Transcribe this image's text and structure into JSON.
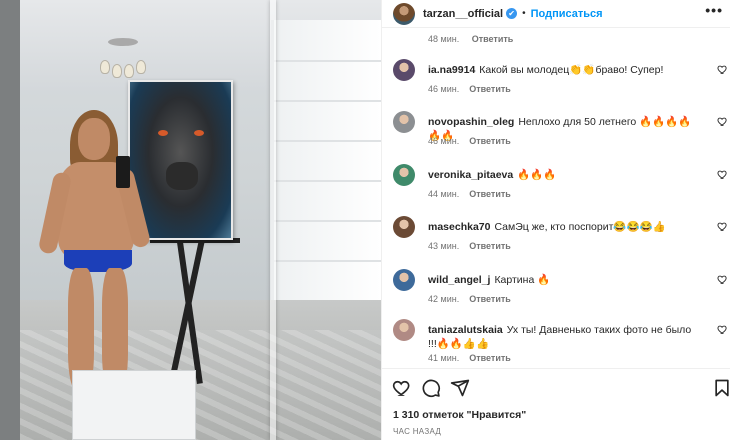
{
  "post": {
    "username": "tarzan__official",
    "verified_mark": "✔",
    "separator": "•",
    "follow_label": "Подписаться",
    "more_label": "•••",
    "photo_alt_icon": "post-photo"
  },
  "first_meta": {
    "time": "48 мин.",
    "reply": "Ответить"
  },
  "comments": [
    {
      "user": "ia.na9914",
      "text": "Какой вы молодец👏👏браво! Супер!",
      "time": "46 мин.",
      "reply": "Ответить",
      "avatar_color": "#5a4a6a"
    },
    {
      "user": "novopashin_oleg",
      "text": "Неплохо для 50 летнего 🔥🔥🔥🔥🔥🔥",
      "time": "46 мин.",
      "reply": "Ответить",
      "avatar_color": "#8c8f92"
    },
    {
      "user": "veronika_pitaeva",
      "text": "🔥🔥🔥",
      "time": "44 мин.",
      "reply": "Ответить",
      "avatar_color": "#3f8a6a"
    },
    {
      "user": "masechka70",
      "text": "СамЭц же, кто поспорит😂😂😂👍",
      "time": "43 мин.",
      "reply": "Ответить",
      "avatar_color": "#6b4a35"
    },
    {
      "user": "wild_angel_j",
      "text": "Картина 🔥",
      "time": "42 мин.",
      "reply": "Ответить",
      "avatar_color": "#3e6a9a"
    },
    {
      "user": "taniazalutskaia",
      "text": "Ух ты! Давненько таких фото не было !!!🔥🔥👍👍",
      "time": "41 мин.",
      "reply": "Ответить",
      "avatar_color": "#b08a84"
    }
  ],
  "actions": {
    "likes": "1 310 отметок \"Нравится\"",
    "time": "ЧАС НАЗАД"
  },
  "colors": {
    "link": "#0095f6",
    "verified": "#3797f0",
    "muted": "#737373"
  }
}
